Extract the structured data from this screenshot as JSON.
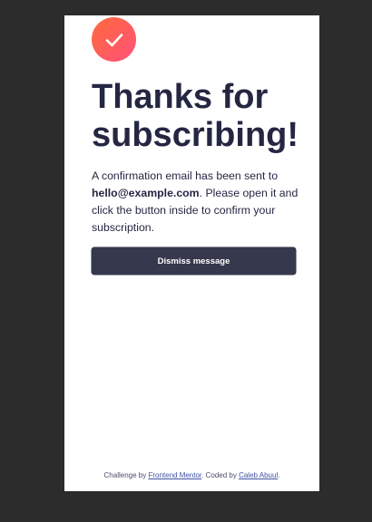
{
  "icon": "checkmark-icon",
  "colors": {
    "background": "#2c2c2c",
    "card": "#ffffff",
    "heading": "#242742",
    "button": "#36384e",
    "icon_gradient_start": "#ff6a3a",
    "icon_gradient_end": "#ff527b",
    "link": "#3e52a3"
  },
  "heading": "Thanks for subscribing!",
  "message": {
    "before_email": "A confirmation email has been sent to ",
    "email": "hello@example.com",
    "after_email": ". Please open it and click the button inside to confirm your subscription."
  },
  "button": {
    "label": "Dismiss message"
  },
  "attribution": {
    "challenge_prefix": "Challenge by ",
    "challenge_link": "Frontend Mentor",
    "coded_prefix": ". Coded by ",
    "coded_link": "Caleb Abuul",
    "suffix": "."
  }
}
